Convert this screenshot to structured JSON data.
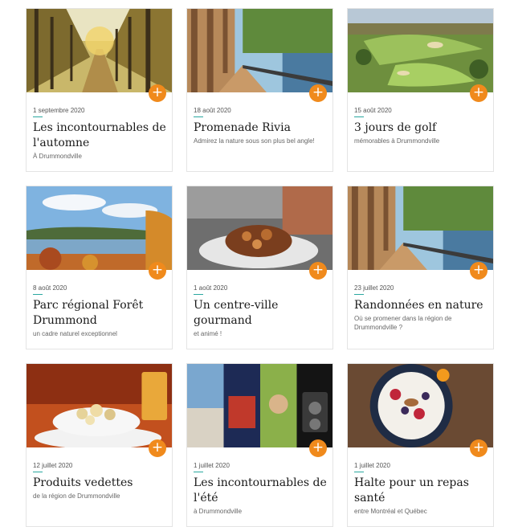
{
  "cards": [
    {
      "date": "1 septembre 2020",
      "title": "Les incontournables de l'automne",
      "subtitle": "À Drummondville",
      "image": "autumn-tree-lined-path"
    },
    {
      "date": "18 août 2020",
      "title": "Promenade Rivia",
      "subtitle": "Admirez la nature sous son plus bel angle!",
      "image": "riverside-boardwalk"
    },
    {
      "date": "15 août 2020",
      "title": "3 jours de golf",
      "subtitle": "mémorables à Drummondville",
      "image": "aerial-golf-course"
    },
    {
      "date": "8 août 2020",
      "title": "Parc régional Forêt Drummond",
      "subtitle": "un cadre naturel exceptionnel",
      "image": "autumn-lake-forest"
    },
    {
      "date": "1 août 2020",
      "title": "Un centre-ville gourmand",
      "subtitle": "et animé !",
      "image": "poutine-dish"
    },
    {
      "date": "23 juillet 2020",
      "title": "Randonnées en nature",
      "subtitle": "Où se promener dans la région de Drummondville ?",
      "image": "riverside-boardwalk"
    },
    {
      "date": "12 juillet 2020",
      "title": "Produits vedettes",
      "subtitle": "de la région de Drummondville",
      "image": "cheese-curds-plate"
    },
    {
      "date": "1 juillet 2020",
      "title": "Les incontournables de l'été",
      "subtitle": "à Drummondville",
      "image": "summer-collage"
    },
    {
      "date": "1 juillet 2020",
      "title": "Halte pour un repas santé",
      "subtitle": "entre Montréal et Québec",
      "image": "smoothie-bowl"
    }
  ],
  "colors": {
    "accent": "#f08a1c",
    "date_rule": "#2aa8a0"
  },
  "icons": {
    "add": "plus-icon"
  },
  "plus_glyph": "+"
}
